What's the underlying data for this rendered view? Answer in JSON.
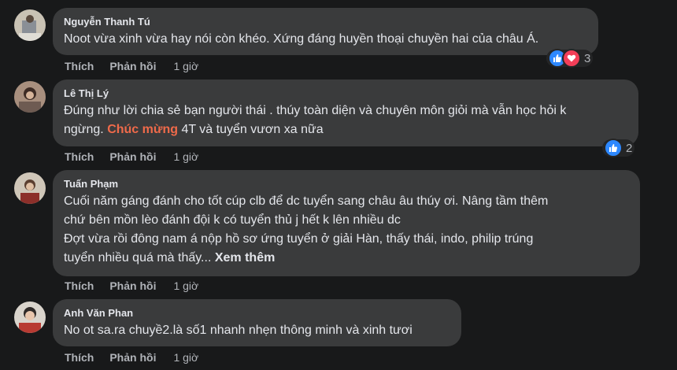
{
  "actions": {
    "like": "Thích",
    "reply": "Phản hồi",
    "see_more": "Xem thêm"
  },
  "colors": {
    "background": "#18191a",
    "bubble": "#3a3b3c",
    "like_blue": "#2d88ff",
    "love_red": "#f33e58",
    "highlight": "#f06a4a"
  },
  "comments": [
    {
      "author": "Nguyễn Thanh Tú",
      "lines": [
        "Noot vừa xinh vừa hay nói còn khéo. Xứng đáng huyền thoại chuyền hai của châu Á."
      ],
      "time": "1 giờ",
      "reactions": [
        "like-icon",
        "love-icon"
      ],
      "reaction_count": "3"
    },
    {
      "author": "Lê Thị Lý",
      "line1": "Đúng như lời chia sẻ bạn người thái . thúy toàn diện và chuyên môn giỏi mà vẫn học hỏi k",
      "line2_a": "ngừng. ",
      "line2_hl": "Chúc mừng",
      "line2_b": " 4T và tuyển vươn xa nữa",
      "time": "1 giờ",
      "reactions": [
        "like-icon"
      ],
      "reaction_count": "2"
    },
    {
      "author": "Tuấn Phạm",
      "lines": [
        "Cuối năm gáng đánh cho tốt cúp clb để dc tuyển sang châu âu thúy ơi. Nâng tầm thêm",
        "chứ bên mồn lèo đánh đội k có tuyển thủ j hết k lên nhiều dc",
        "Đợt vừa rồi đông nam á nộp hồ sơ ứng tuyển ở giải Hàn, thấy thái, indo, philip trúng",
        "tuyển nhiều quá mà thấy..."
      ],
      "time": "1 giờ"
    },
    {
      "author": "Anh Văn Phan",
      "lines": [
        "No ot sa.ra chuyề2.là số1 nhanh nhẹn thông minh và xinh tươi"
      ],
      "time": "1 giờ"
    }
  ]
}
